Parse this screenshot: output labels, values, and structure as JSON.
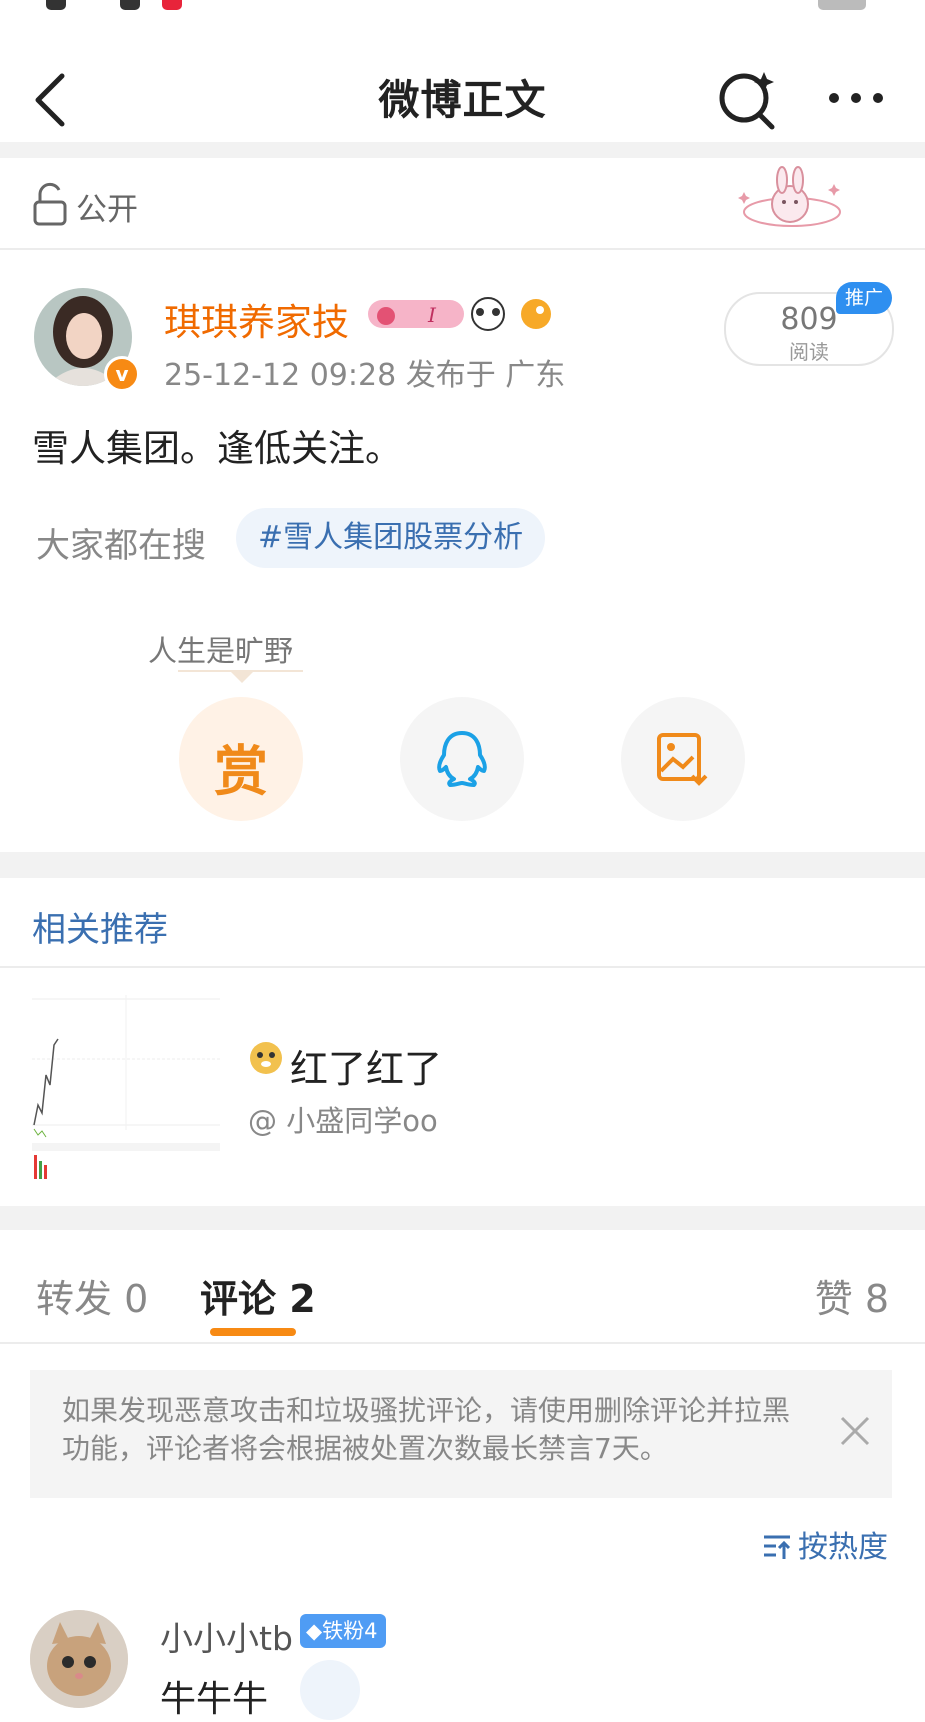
{
  "nav": {
    "title": "微博正文",
    "icons": {
      "back": "chevron-left-icon",
      "search": "search-sparkle-icon",
      "more": "more-dots-icon"
    }
  },
  "visibility": {
    "icon": "unlock-icon",
    "label": "公开"
  },
  "post": {
    "author": "琪琪养家技",
    "verified_icon": "verified-v-icon",
    "meta": "25-12-12 09:28  发布于 广东",
    "read_count": "809",
    "read_label": "阅读",
    "promo_tag": "推广",
    "text": "雪人集团。逢低关注。",
    "search_label": "大家都在搜",
    "hashtag": "#雪人集团股票分析",
    "reward_user": "人生是旷野",
    "reward_button": "赏",
    "share_icons": [
      "qq-icon",
      "save-image-icon"
    ]
  },
  "related": {
    "header": "相关推荐",
    "item": {
      "title": "红了红了",
      "user": "@ 小盛同学oo",
      "emoji_icon": "doge-icon"
    }
  },
  "tabs": {
    "repost": "转发 0",
    "comment": "评论 2",
    "like": "赞 8"
  },
  "notice": {
    "text": "如果发现恶意攻击和垃圾骚扰评论，请使用删除评论并拉黑功能，评论者将会根据被处置次数最长禁言7天。"
  },
  "sort": {
    "label": "按热度",
    "icon": "sort-icon"
  },
  "comment": {
    "user": "小小小tb",
    "badge": "铁粉4",
    "text": "牛牛牛"
  },
  "colors": {
    "accent_orange": "#f78a14",
    "link_blue": "#3a6fb0",
    "promo_blue": "#2e8ff0",
    "author_orange": "#f06a00"
  }
}
